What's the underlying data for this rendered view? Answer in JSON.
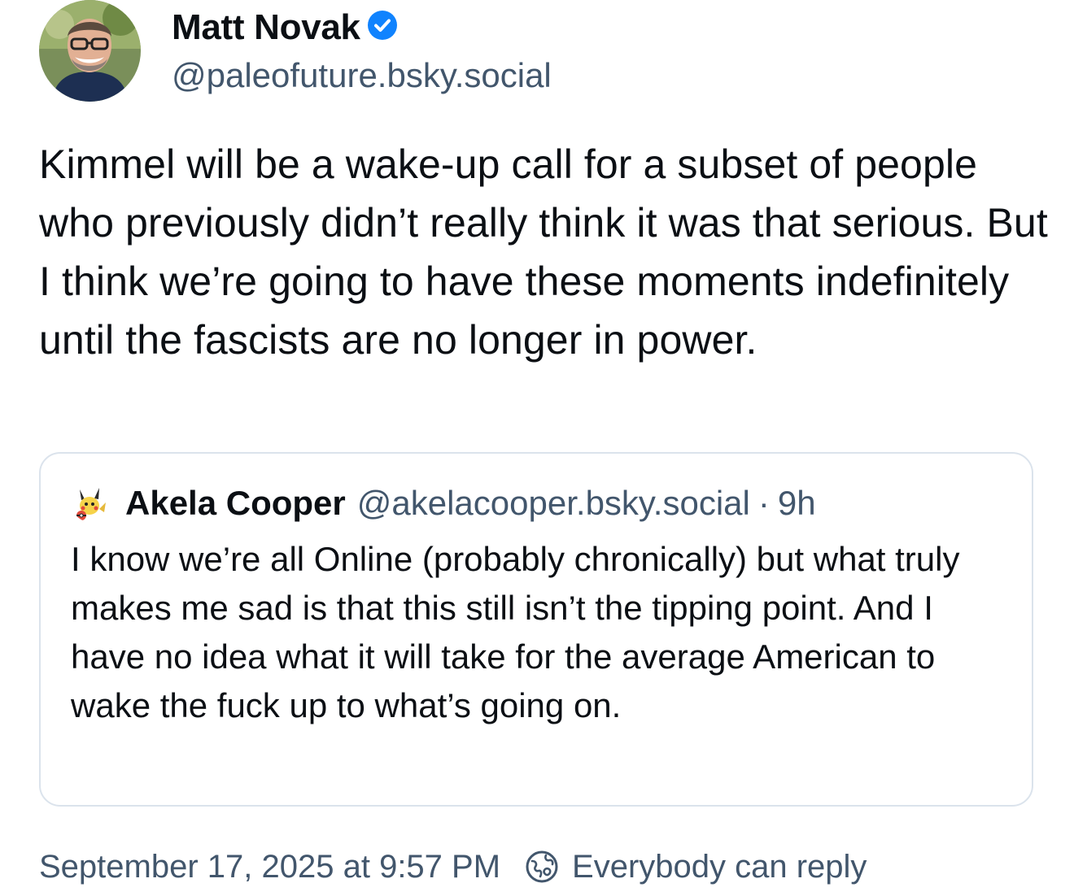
{
  "author": {
    "display_name": "Matt Novak",
    "handle": "@paleofuture.bsky.social",
    "verified_color": "#1083fe",
    "avatar_icon": "avatar-photo-smiling-man-glasses"
  },
  "post": {
    "text": "Kimmel will be a wake-up call for a subset of people who previously didn’t really think it was that serious. But I think we’re going to have these moments indefinitely until the fascists are no longer in power."
  },
  "quote": {
    "display_name": "Akela Cooper",
    "handle": "@akelacooper.bsky.social",
    "separator": "·",
    "time": "9h",
    "avatar_icon": "avatar-pikachu",
    "text": "I know we’re all Online (probably chronically) but what truly makes me sad is that this still isn’t the tipping point. And I have no idea what it will take for the average American to wake the fuck up to what’s going on."
  },
  "footer": {
    "timestamp": "September 17, 2025 at 9:57 PM",
    "reply_setting": "Everybody can reply",
    "reply_icon": "globe-reply-icon"
  },
  "colors": {
    "text_primary": "#0b0f14",
    "text_secondary": "#42566c",
    "border": "#dbe3ec",
    "accent": "#1083fe"
  }
}
